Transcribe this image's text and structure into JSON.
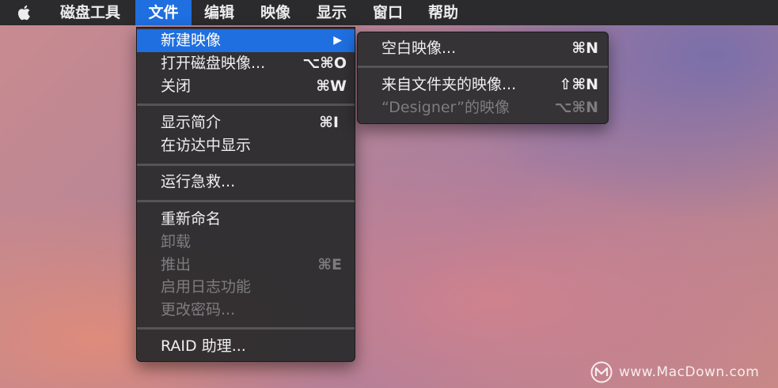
{
  "menubar": {
    "items": [
      {
        "label": "磁盘工具"
      },
      {
        "label": "文件",
        "active": true
      },
      {
        "label": "编辑"
      },
      {
        "label": "映像"
      },
      {
        "label": "显示"
      },
      {
        "label": "窗口"
      },
      {
        "label": "帮助"
      }
    ],
    "active_color": "#1f6fe0"
  },
  "file_menu": {
    "items": [
      {
        "label": "新建映像",
        "arrow": "▶",
        "highlighted": true
      },
      {
        "label": "打开磁盘映像...",
        "shortcut": "⌥⌘O"
      },
      {
        "label": "关闭",
        "shortcut": "⌘W"
      },
      {
        "label": "显示简介",
        "shortcut": "⌘I"
      },
      {
        "label": "在访达中显示"
      },
      {
        "label": "运行急救..."
      },
      {
        "label": "重新命名"
      },
      {
        "label": "卸载",
        "disabled": true
      },
      {
        "label": "推出",
        "shortcut": "⌘E",
        "disabled": true
      },
      {
        "label": "启用日志功能",
        "disabled": true
      },
      {
        "label": "更改密码...",
        "disabled": true
      },
      {
        "label": "RAID 助理..."
      }
    ]
  },
  "new_image_submenu": {
    "items": [
      {
        "label": "空白映像...",
        "shortcut": "⌘N"
      },
      {
        "label": "来自文件夹的映像...",
        "shortcut": "⇧⌘N"
      },
      {
        "label": "“Designer”的映像",
        "shortcut": "⌥⌘N",
        "disabled": true
      }
    ]
  },
  "watermark": {
    "text": "www.MacDown.com",
    "logo_icon": "macdown-logo-icon"
  },
  "icons": {
    "apple": "apple-logo-icon"
  }
}
